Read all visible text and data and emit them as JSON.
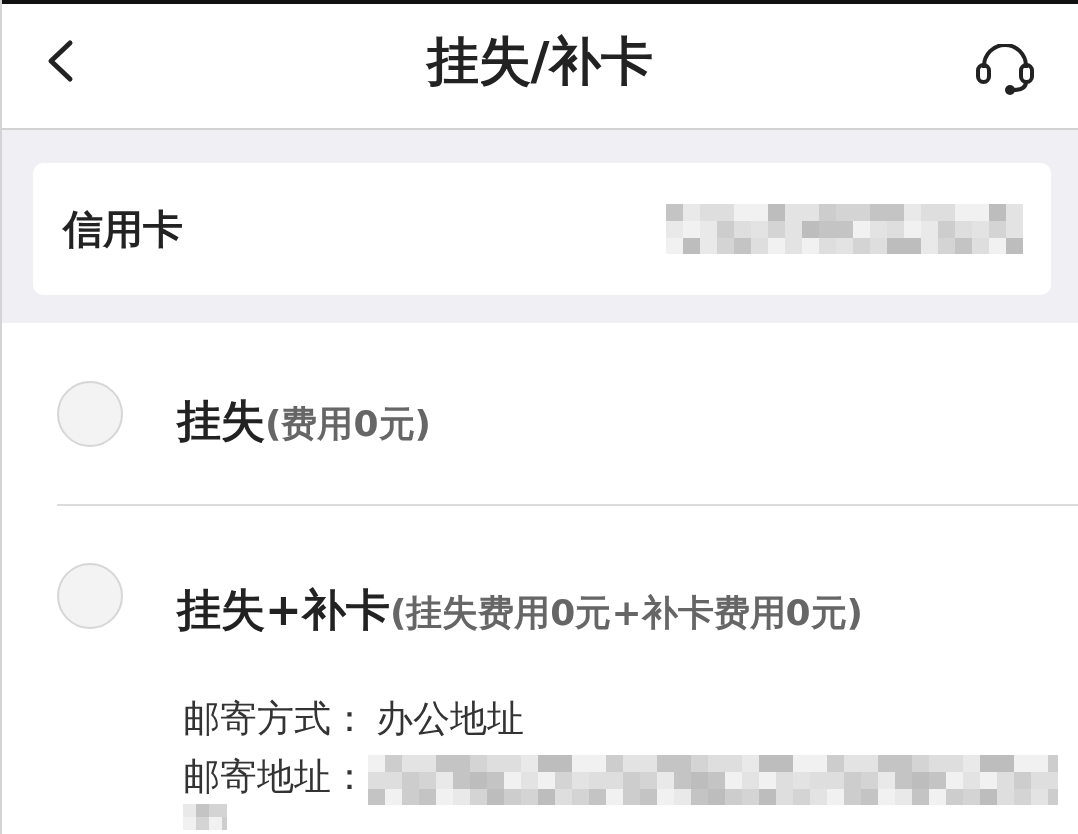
{
  "header": {
    "title": "挂失/补卡"
  },
  "card": {
    "label": "信用卡",
    "number_masked": true
  },
  "options": [
    {
      "title": "挂失",
      "fee": "(费用0元)",
      "selected": false
    },
    {
      "title": "挂失+补卡",
      "fee": "(挂失费用0元+补卡费用0元)",
      "selected": false,
      "details": [
        {
          "label": "邮寄方式：",
          "value": "办公地址"
        },
        {
          "label": "邮寄地址：",
          "value_masked": true
        }
      ]
    }
  ]
}
